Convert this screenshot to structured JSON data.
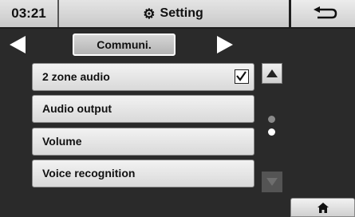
{
  "header": {
    "time": "03:21",
    "title": "Setting",
    "title_icon": "gear-icon",
    "back_icon": "return-arrow-icon"
  },
  "category": {
    "current": "Communi.",
    "prev_icon": "triangle-left-icon",
    "next_icon": "triangle-right-icon"
  },
  "list": {
    "items": [
      {
        "label": "2 zone audio",
        "checked": true
      },
      {
        "label": "Audio output"
      },
      {
        "label": "Volume"
      },
      {
        "label": "Voice recognition"
      }
    ]
  },
  "scroll": {
    "up_icon": "triangle-up-icon",
    "down_icon": "triangle-down-icon",
    "pages": 2,
    "current_page": 2
  },
  "footer": {
    "home_icon": "home-icon"
  }
}
